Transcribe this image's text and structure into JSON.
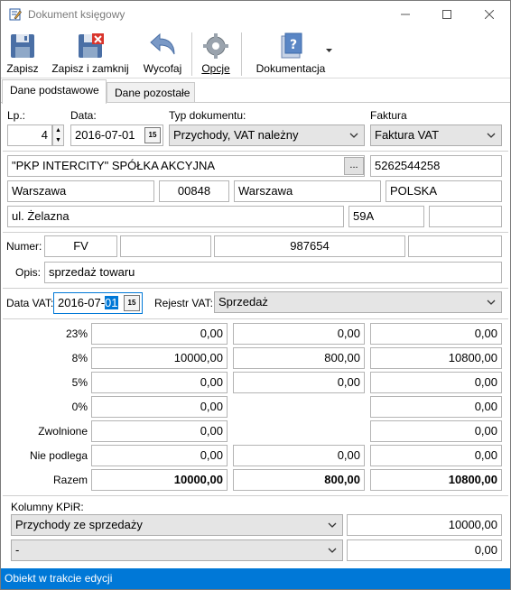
{
  "window": {
    "title": "Dokument księgowy"
  },
  "toolbar": {
    "save": "Zapisz",
    "save_close": "Zapisz i zamknij",
    "undo": "Wycofaj",
    "options": "Opcje",
    "docs": "Dokumentacja"
  },
  "tabs": {
    "basic": "Dane podstawowe",
    "other": "Dane pozostałe"
  },
  "header": {
    "lp_label": "Lp.:",
    "lp_value": "4",
    "date_label": "Data:",
    "date_value": "2016-07-01",
    "type_label": "Typ dokumentu:",
    "type_value": "Przychody, VAT należny",
    "invoice_label": "Faktura",
    "invoice_value": "Faktura VAT"
  },
  "contractor": {
    "name": "\"PKP INTERCITY\" SPÓŁKA AKCYJNA",
    "nip": "5262544258",
    "city": "Warszawa",
    "postcode": "00848",
    "post_city": "Warszawa",
    "country": "POLSKA",
    "street": "ul. Żelazna",
    "house_no": "59A",
    "flat_no": ""
  },
  "number": {
    "label": "Numer:",
    "prefix": "FV",
    "part2": "",
    "value": "987654",
    "suffix": ""
  },
  "description": {
    "label": "Opis:",
    "value": "sprzedaż towaru"
  },
  "vat": {
    "date_label": "Data VAT:",
    "date_value_main": "2016-07-",
    "date_value_sel": "01",
    "register_label": "Rejestr VAT:",
    "register_value": "Sprzedaż"
  },
  "rates": [
    {
      "label": "23%",
      "net": "0,00",
      "vat": "0,00",
      "gross": "0,00"
    },
    {
      "label": "8%",
      "net": "10000,00",
      "vat": "800,00",
      "gross": "10800,00"
    },
    {
      "label": "5%",
      "net": "0,00",
      "vat": "0,00",
      "gross": "0,00"
    },
    {
      "label": "0%",
      "net": "0,00",
      "vat": "",
      "gross": "0,00"
    },
    {
      "label": "Zwolnione",
      "net": "0,00",
      "vat": "",
      "gross": "0,00"
    },
    {
      "label": "Nie podlega",
      "net": "0,00",
      "vat": "0,00",
      "gross": "0,00"
    },
    {
      "label": "Razem",
      "net": "10000,00",
      "vat": "800,00",
      "gross": "10800,00"
    }
  ],
  "kpir": {
    "label": "Kolumny KPiR:",
    "row1_combo": "Przychody ze sprzedaży",
    "row1_value": "10000,00",
    "row2_combo": "-",
    "row2_value": "0,00"
  },
  "status": {
    "text": "Obiekt w trakcie edycji"
  },
  "colors": {
    "accent": "#0078d7"
  }
}
